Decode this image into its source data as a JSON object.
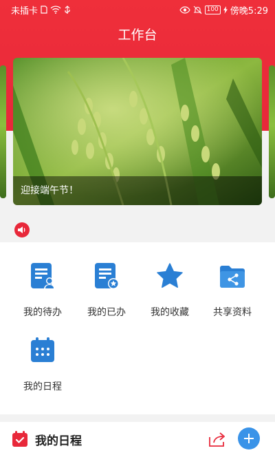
{
  "status_bar": {
    "carrier": "未插卡",
    "battery": "100",
    "time": "傍晚5:29"
  },
  "header": {
    "title": "工作台"
  },
  "banner": {
    "caption": "迎接端午节！"
  },
  "grid": {
    "items": [
      {
        "label": "我的待办",
        "icon": "todo-icon"
      },
      {
        "label": "我的已办",
        "icon": "done-icon"
      },
      {
        "label": "我的收藏",
        "icon": "star-icon"
      },
      {
        "label": "共享资料",
        "icon": "shared-folder-icon"
      },
      {
        "label": "我的日程",
        "icon": "calendar-icon"
      }
    ]
  },
  "schedule": {
    "title": "我的日程"
  },
  "colors": {
    "brand_red": "#e8283a",
    "accent_blue": "#2a7fd4",
    "add_blue": "#3a93e8"
  }
}
